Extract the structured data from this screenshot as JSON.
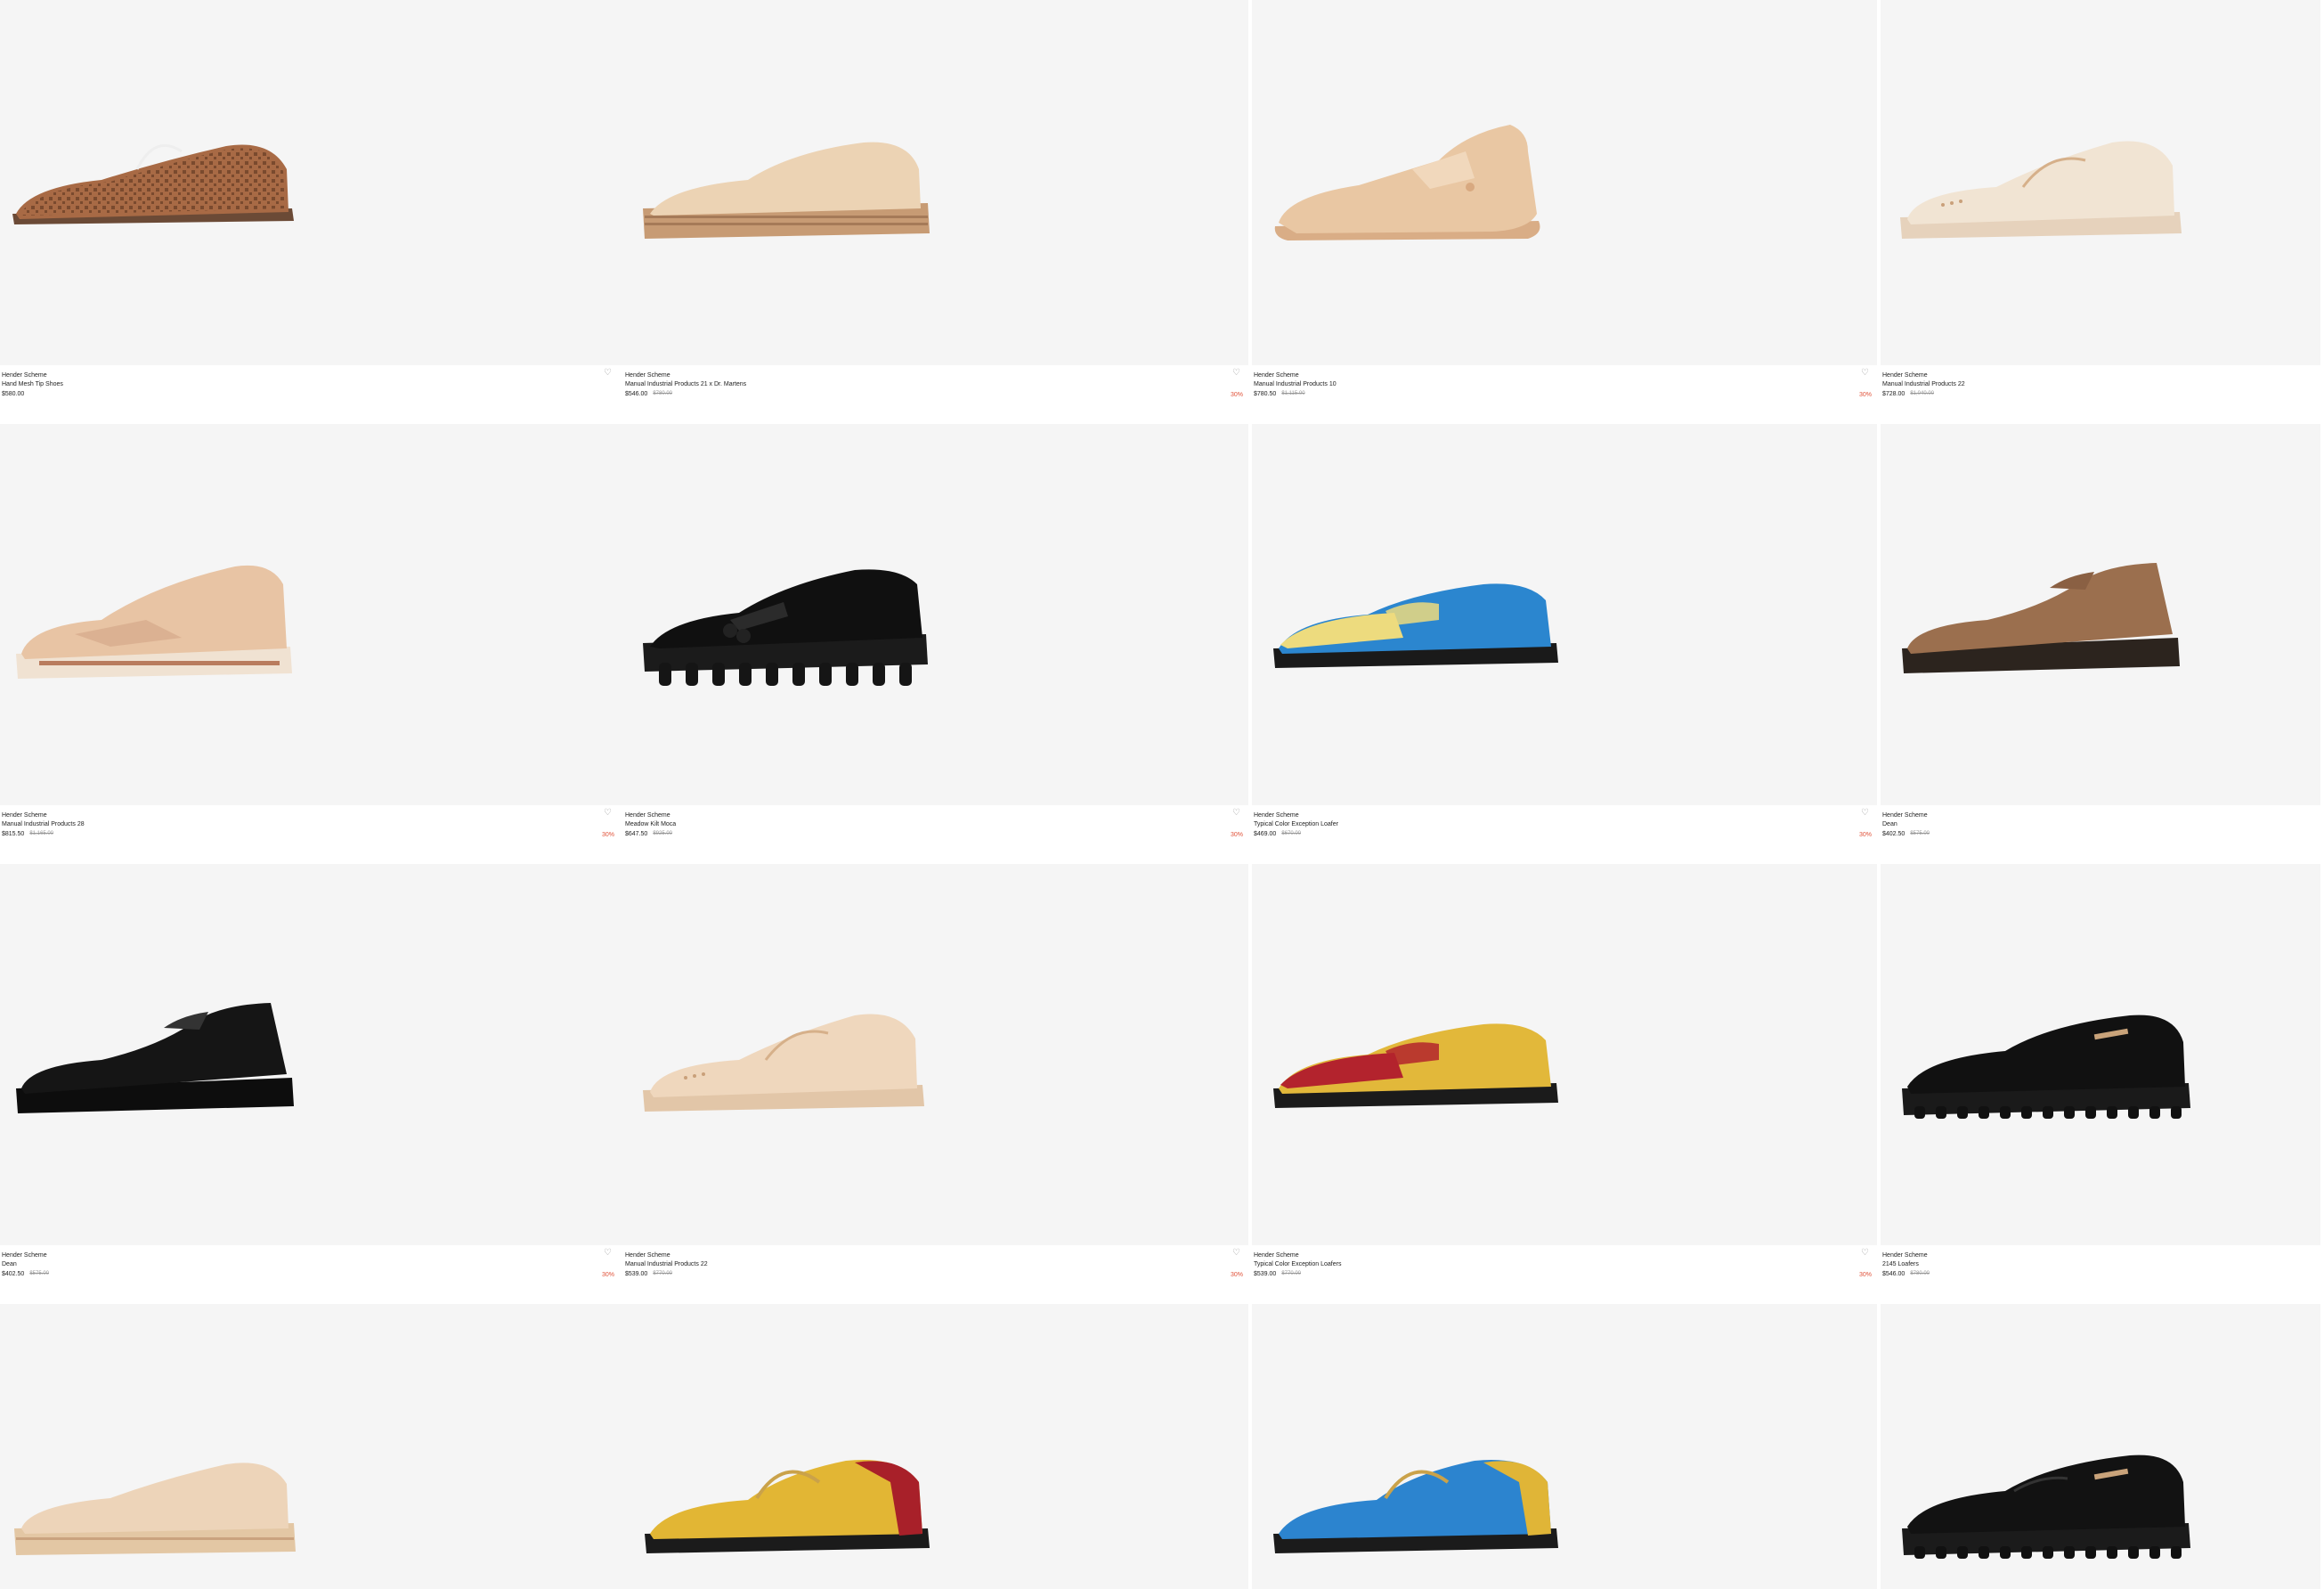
{
  "products": [
    {
      "brand": "Hender Scheme",
      "name": "Hand Mesh Tip Shoes",
      "price": "$580.00",
      "old_price": "",
      "discount": "",
      "heart": "♡",
      "shoe": "woven-brown-oxford"
    },
    {
      "brand": "Hender Scheme",
      "name": "Manual Industrial Products 21 x Dr. Martens",
      "price": "$546.00",
      "old_price": "$780.00",
      "discount": "30%",
      "heart": "♡",
      "shoe": "natural-derby"
    },
    {
      "brand": "Hender Scheme",
      "name": "Manual Industrial Products 10",
      "price": "$780.50",
      "old_price": "$1,115.00",
      "discount": "30%",
      "heart": "♡",
      "shoe": "natural-highsneaker"
    },
    {
      "brand": "Hender Scheme",
      "name": "Manual Industrial Products 22",
      "price": "$728.00",
      "old_price": "$1,040.00",
      "discount": "",
      "heart": "",
      "shoe": "cream-lowsneaker"
    },
    {
      "brand": "Hender Scheme",
      "name": "Manual Industrial Products 28",
      "price": "$815.50",
      "old_price": "$1,165.00",
      "discount": "30%",
      "heart": "♡",
      "shoe": "natural-runner"
    },
    {
      "brand": "Hender Scheme",
      "name": "Meadow Kilt Moca",
      "price": "$647.50",
      "old_price": "$925.00",
      "discount": "30%",
      "heart": "♡",
      "shoe": "black-kilt-loafer"
    },
    {
      "brand": "Hender Scheme",
      "name": "Typical Color Exception Loafer",
      "price": "$469.00",
      "old_price": "$670.00",
      "discount": "30%",
      "heart": "♡",
      "shoe": "blue-yellow-loafer"
    },
    {
      "brand": "Hender Scheme",
      "name": "Dean",
      "price": "$402.50",
      "old_price": "$575.00",
      "discount": "",
      "heart": "",
      "shoe": "brown-suede-slipon"
    },
    {
      "brand": "Hender Scheme",
      "name": "Dean",
      "price": "$402.50",
      "old_price": "$575.00",
      "discount": "30%",
      "heart": "♡",
      "shoe": "black-suede-slipon"
    },
    {
      "brand": "Hender Scheme",
      "name": "Manual Industrial Products 22",
      "price": "$539.00",
      "old_price": "$770.00",
      "discount": "30%",
      "heart": "♡",
      "shoe": "natural-lowsneaker"
    },
    {
      "brand": "Hender Scheme",
      "name": "Typical Color Exception Loafers",
      "price": "$539.00",
      "old_price": "$770.00",
      "discount": "30%",
      "heart": "♡",
      "shoe": "yellow-red-loafer"
    },
    {
      "brand": "Hender Scheme",
      "name": "2145 Loafers",
      "price": "$546.00",
      "old_price": "$780.00",
      "discount": "",
      "heart": "",
      "shoe": "black-lug-loafer"
    },
    {
      "brand": "",
      "name": "",
      "price": "",
      "old_price": "",
      "discount": "",
      "heart": "",
      "shoe": "natural-espadrille"
    },
    {
      "brand": "",
      "name": "",
      "price": "",
      "old_price": "",
      "discount": "",
      "heart": "",
      "shoe": "yellow-red-derby"
    },
    {
      "brand": "",
      "name": "",
      "price": "",
      "old_price": "",
      "discount": "",
      "heart": "",
      "shoe": "blue-yellow-derby"
    },
    {
      "brand": "",
      "name": "",
      "price": "",
      "old_price": "",
      "discount": "",
      "heart": "",
      "shoe": "black-lug-derby"
    }
  ],
  "colors": {
    "card_bg": "#f5f5f5",
    "discount": "#e0533a",
    "natural_leather": "#ecd2b6",
    "cream": "#f3e6d6"
  }
}
